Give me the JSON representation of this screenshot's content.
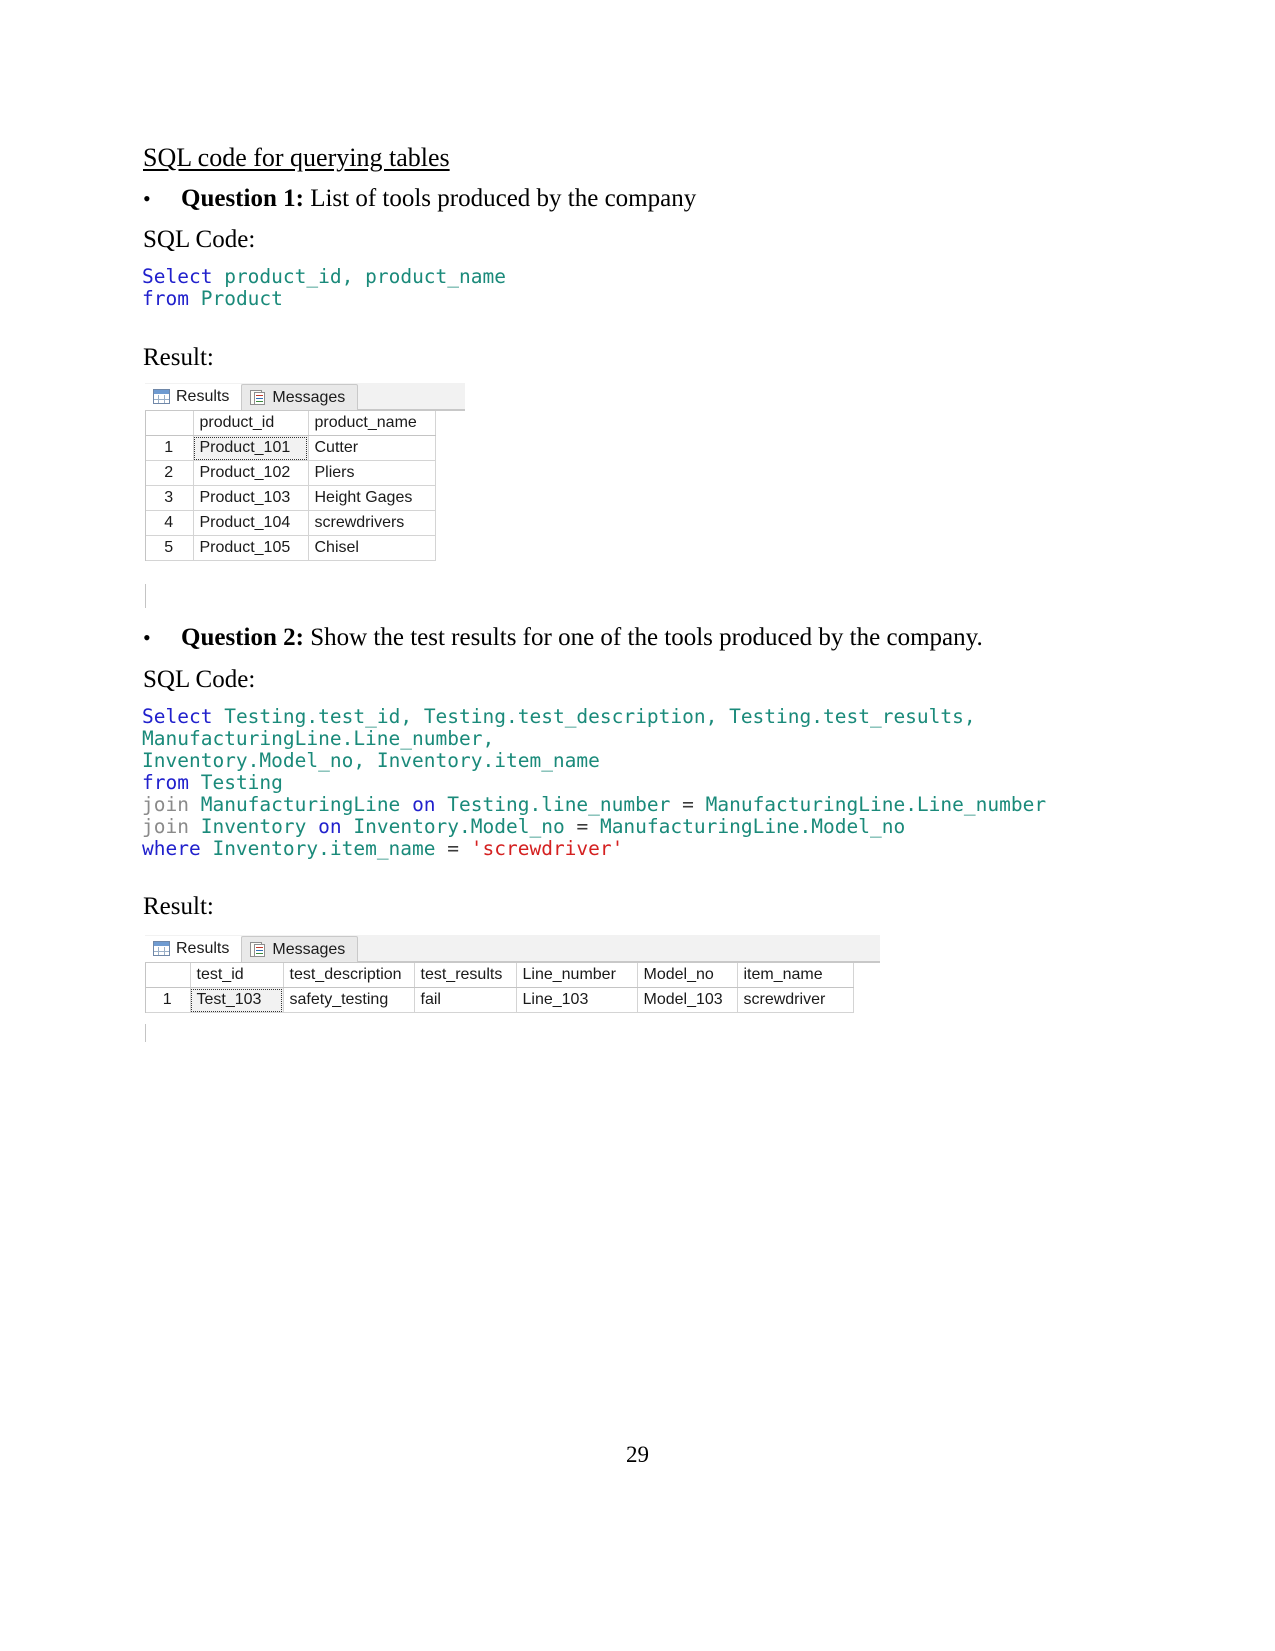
{
  "document": {
    "heading": "SQL code for querying tables",
    "page_number": "29"
  },
  "question1": {
    "bullet": "•",
    "label": "Question 1:",
    "text": " List of tools produced by the company",
    "sql_code_label": "SQL Code:",
    "result_label": "Result:",
    "code": {
      "line1_kw": "Select",
      "line1_ident_a": "product_id",
      "line1_comma": ",",
      "line1_ident_b": "product_name",
      "line2_kw": "from",
      "line2_ident": "Product"
    },
    "grid": {
      "tabs": [
        {
          "label": "Results",
          "icon": "grid-icon",
          "active": true
        },
        {
          "label": "Messages",
          "icon": "messages-icon",
          "active": false
        }
      ],
      "columns": [
        "",
        "product_id",
        "product_name"
      ],
      "rows": [
        {
          "n": "1",
          "product_id": "Product_101",
          "product_name": "Cutter"
        },
        {
          "n": "2",
          "product_id": "Product_102",
          "product_name": "Pliers"
        },
        {
          "n": "3",
          "product_id": "Product_103",
          "product_name": "Height Gages"
        },
        {
          "n": "4",
          "product_id": "Product_104",
          "product_name": "screwdrivers"
        },
        {
          "n": "5",
          "product_id": "Product_105",
          "product_name": "Chisel"
        }
      ]
    }
  },
  "question2": {
    "bullet": "•",
    "label": "Question 2:",
    "text": " Show the test results for one of the tools produced by the company.",
    "sql_code_label": "SQL Code:",
    "result_label": "Result:",
    "code": {
      "l1_kw": "Select",
      "l1_a": "Testing.test_id",
      "l1_c1": ",",
      "l1_b": "Testing.test_description",
      "l1_c2": ",",
      "l1_c": "Testing.test_results",
      "l1_c3": ",",
      "l2_a": "ManufacturingLine.Line_number",
      "l2_c1": ",",
      "l3_a": "Inventory.Model_no",
      "l3_c1": ",",
      "l3_b": "Inventory.item_name",
      "l4_kw": "from",
      "l4_a": "Testing",
      "l5_join": "join",
      "l5_a": "ManufacturingLine",
      "l5_on": "on",
      "l5_b": "Testing.line_number",
      "l5_eq": "=",
      "l5_c": "ManufacturingLine.Line_number",
      "l6_join": "join",
      "l6_a": "Inventory",
      "l6_on": "on",
      "l6_b": "Inventory.Model_no",
      "l6_eq": "=",
      "l6_c": "ManufacturingLine.Model_no",
      "l7_kw": "where",
      "l7_a": "Inventory.item_name",
      "l7_eq": "=",
      "l7_str": "'screwdriver'"
    },
    "grid": {
      "tabs": [
        {
          "label": "Results",
          "icon": "grid-icon",
          "active": true
        },
        {
          "label": "Messages",
          "icon": "messages-icon",
          "active": false
        }
      ],
      "columns": [
        "",
        "test_id",
        "test_description",
        "test_results",
        "Line_number",
        "Model_no",
        "item_name"
      ],
      "rows": [
        {
          "n": "1",
          "test_id": "Test_103",
          "test_description": "safety_testing",
          "test_results": "fail",
          "Line_number": "Line_103",
          "Model_no": "Model_103",
          "item_name": "screwdriver"
        }
      ]
    }
  },
  "colors": {
    "keyword": "#2020cc",
    "identifier": "#1a8a7a",
    "string": "#d42020",
    "dim_keyword": "#8a8a8a"
  }
}
